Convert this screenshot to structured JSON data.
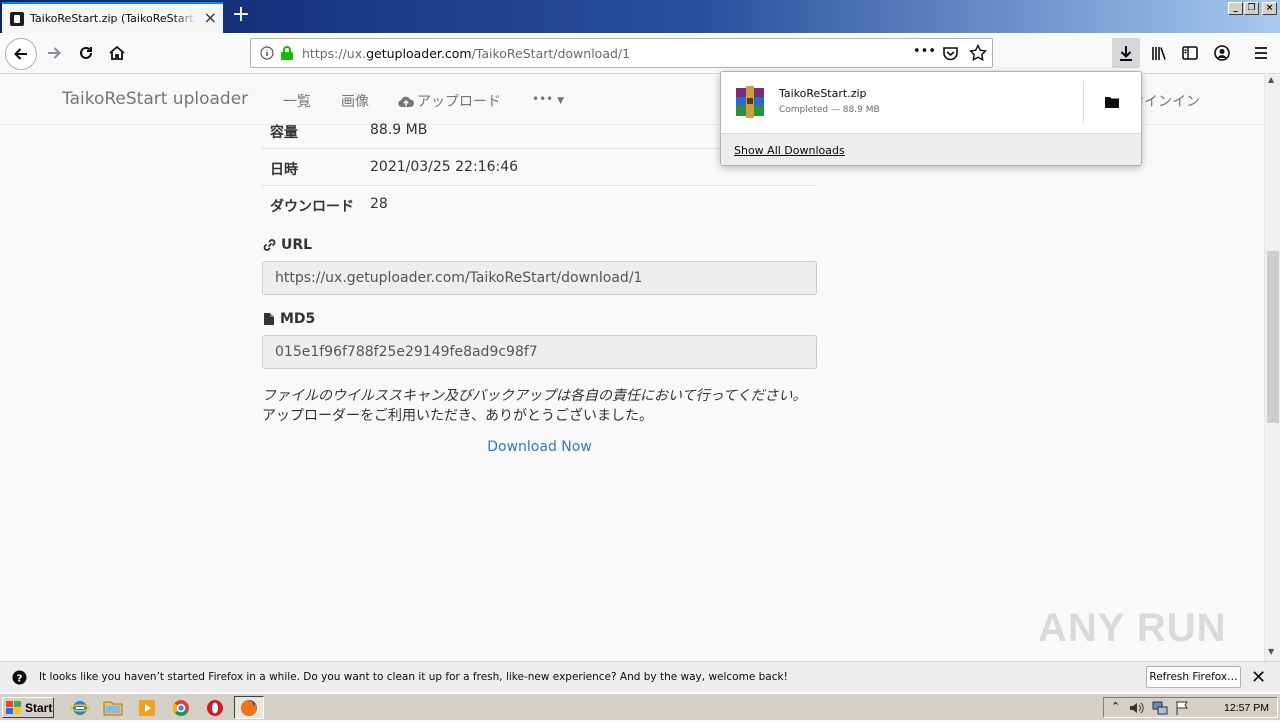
{
  "browser": {
    "tab_title": "TaikoReStart.zip (TaikoReStart.zip)",
    "url_prefix": "https://ux.",
    "url_domain": "getuploader.com",
    "url_path": "/TaikoReStart/download/1",
    "window_controls": [
      "_",
      "❐",
      "×"
    ]
  },
  "site": {
    "brand": "TaikoReStart uploader",
    "nav": {
      "list": "一覧",
      "images": "画像",
      "upload": "アップロード",
      "more": "•••",
      "signin": "サインイン"
    }
  },
  "details": {
    "size_label": "容量",
    "size_value": "88.9 MB",
    "date_label": "日時",
    "date_value": "2021/03/25 22:16:46",
    "downloads_label": "ダウンロード",
    "downloads_value": "28",
    "url_label": "URL",
    "url_value": "https://ux.getuploader.com/TaikoReStart/download/1",
    "md5_label": "MD5",
    "md5_value": "015e1f96f788f25e29149fe8ad9c98f7",
    "note_line1": "ファイルのウイルススキャン及びバックアップは各自の責任において行ってください。",
    "note_line2": "アップローダーをご利用いただき、ありがとうございました。",
    "download_now": "Download Now"
  },
  "downloads_panel": {
    "file_name": "TaikoReStart.zip",
    "status": "Completed — 88.9 MB",
    "show_all": "Show All Downloads"
  },
  "notification": {
    "message": "It looks like you haven’t started Firefox in a while. Do you want to clean it up for a fresh, like-new experience? And by the way, welcome back!",
    "refresh_button": "Refresh Firefox…"
  },
  "taskbar": {
    "start_label": "Start",
    "clock": "12:57 PM"
  },
  "watermark": "ANY RUN"
}
